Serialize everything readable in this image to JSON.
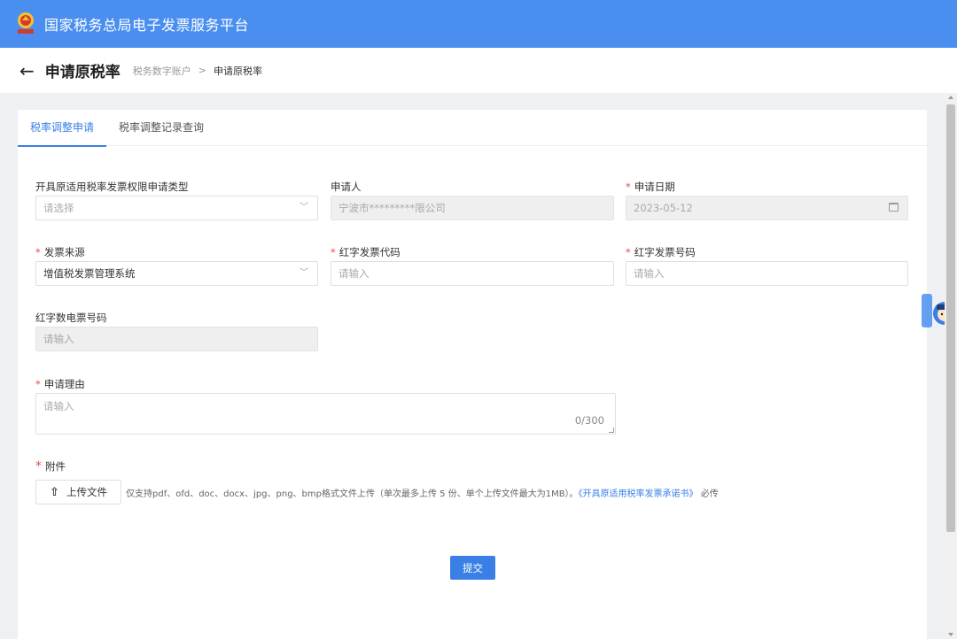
{
  "header": {
    "platform_title": "国家税务总局电子发票服务平台"
  },
  "subheader": {
    "page_title": "申请原税率",
    "breadcrumb": [
      "税务数字账户",
      "申请原税率"
    ],
    "separator": ">"
  },
  "tabs": [
    {
      "label": "税率调整申请",
      "active": true
    },
    {
      "label": "税率调整记录查询",
      "active": false
    }
  ],
  "form": {
    "permission_type": {
      "label": "开具原适用税率发票权限申请类型",
      "required": false,
      "placeholder": "请选择"
    },
    "applicant": {
      "label": "申请人",
      "required": false,
      "value": "宁波市*********限公司"
    },
    "apply_date": {
      "label": "申请日期",
      "required": true,
      "value": "2023-05-12"
    },
    "invoice_source": {
      "label": "发票来源",
      "required": true,
      "value": "增值税发票管理系统"
    },
    "red_invoice_code": {
      "label": "红字发票代码",
      "required": true,
      "placeholder": "请输入"
    },
    "red_invoice_number": {
      "label": "红字发票号码",
      "required": true,
      "placeholder": "请输入"
    },
    "red_digital_invoice_number": {
      "label": "红字数电票号码",
      "required": false,
      "placeholder": "请输入"
    },
    "reason": {
      "label": "申请理由",
      "required": true,
      "placeholder": "请输入",
      "counter": "0/300"
    },
    "attachment": {
      "label": "附件",
      "required": true,
      "upload_label": "上传文件",
      "hint_prefix": "仅支持pdf、ofd、doc、docx、jpg、png、bmp格式文件上传（单次最多上传 5 份、单个上传文件最大为1MB）。",
      "hint_link": "《开具原适用税率发票承诺书》",
      "hint_suffix": "必传"
    },
    "submit_label": "提交"
  },
  "required_mark": "*",
  "colors": {
    "topbar": "#4a8ff0",
    "primary": "#3a7fe6",
    "required": "#e64a4a"
  }
}
